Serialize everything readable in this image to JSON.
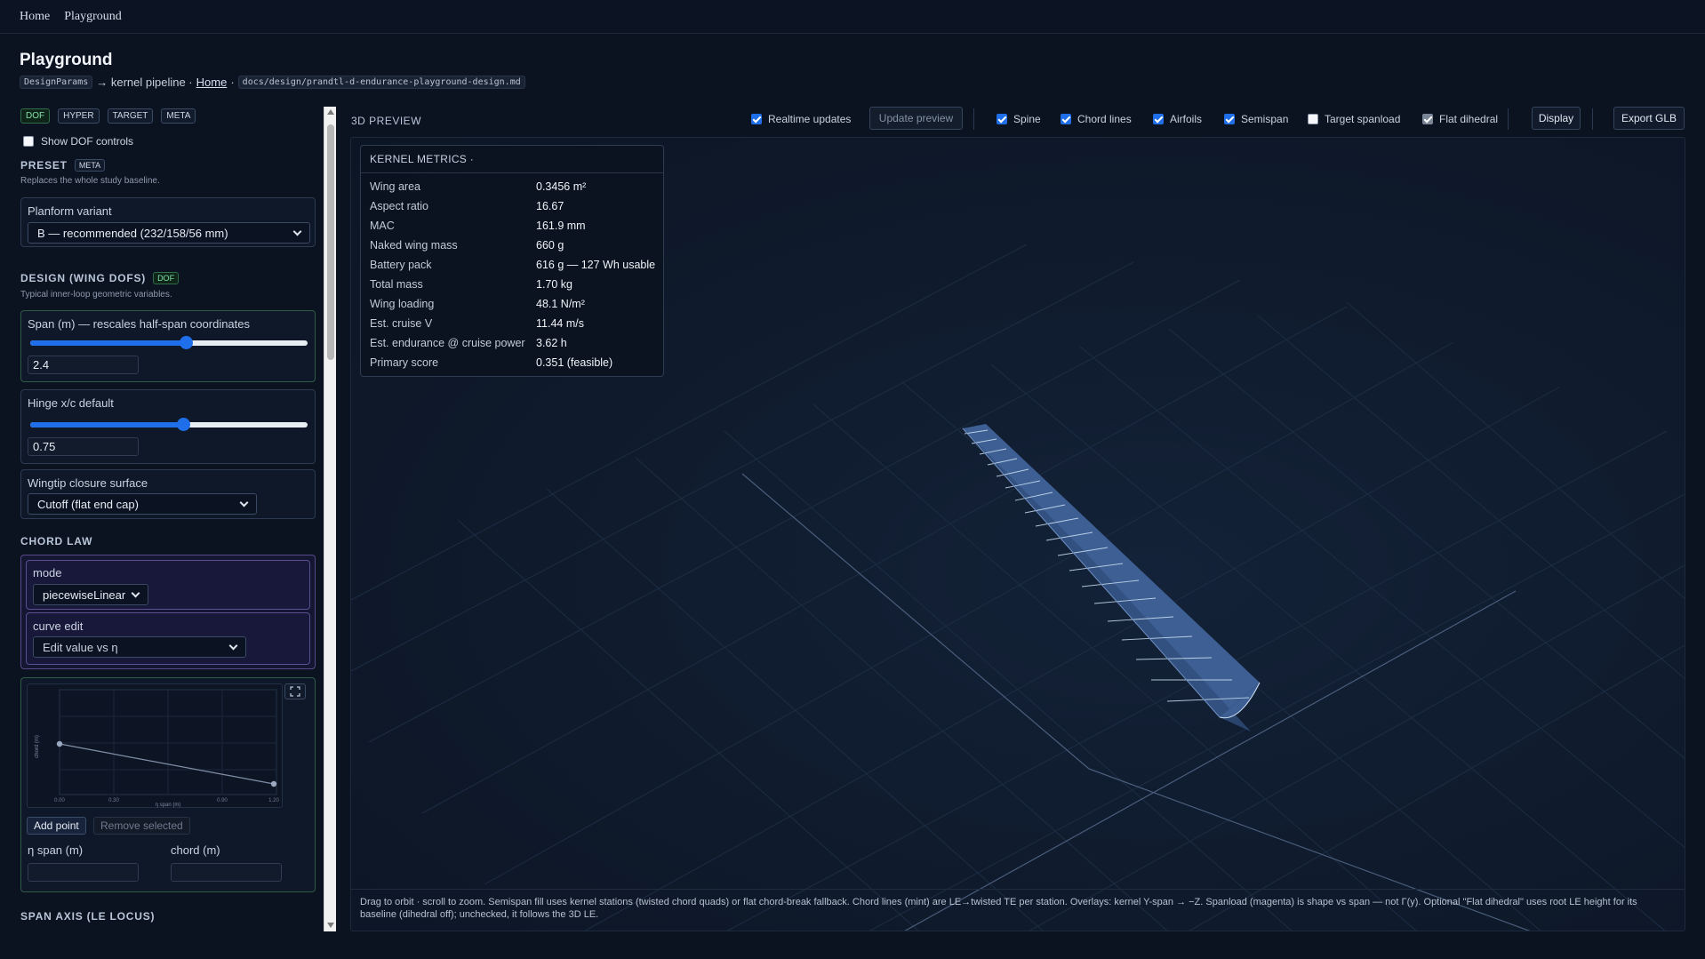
{
  "nav": {
    "home": "Home",
    "playground": "Playground"
  },
  "header": {
    "title": "Playground",
    "code_params": "DesignParams",
    "pipeline_text": "→ kernel pipeline ·",
    "home_link": "Home",
    "dot": "·",
    "doc_path": "docs/design/prandtl-d-endurance-playground-design.md"
  },
  "left": {
    "tags": [
      "DOF",
      "HYPER",
      "TARGET",
      "META"
    ],
    "show_dof": {
      "label": "Show DOF controls",
      "checked": false
    },
    "preset": {
      "heading": "PRESET",
      "tag": "META",
      "sub": "Replaces the whole study baseline.",
      "label": "Planform variant",
      "value": "B — recommended (232/158/56 mm)"
    },
    "design": {
      "heading": "DESIGN (WING DOFS)",
      "tag": "DOF",
      "sub": "Typical inner-loop geometric variables.",
      "span": {
        "label": "Span (m) — rescales half-span coordinates",
        "value": "2.4",
        "level": 0.56
      },
      "hinge": {
        "label": "Hinge x/c default",
        "value": "0.75",
        "level": 0.55
      },
      "wingtip": {
        "label": "Wingtip closure surface",
        "value": "Cutoff (flat end cap)"
      }
    },
    "chord_law": {
      "heading": "CHORD LAW",
      "mode_label": "mode",
      "mode_value": "piecewiseLinear",
      "curve_label": "curve edit",
      "curve_value": "Edit value vs η",
      "chart_ylabel": "chord (m)",
      "chart_xlabel": "η span (m)",
      "chart_ticks": [
        "0.00",
        "0.30",
        "0.90",
        "1.20"
      ],
      "add_point": "Add point",
      "remove_selected": "Remove selected",
      "eta_label": "η span (m)",
      "chord_label": "chord (m)",
      "expand_icon": "expand-icon"
    },
    "span_axis": {
      "heading": "SPAN AXIS (LE LOCUS)"
    }
  },
  "preview": {
    "heading": "3D PREVIEW",
    "toolbar": {
      "realtime": {
        "label": "Realtime updates",
        "checked": true
      },
      "update_btn": "Update preview",
      "spine": {
        "label": "Spine",
        "checked": true
      },
      "chord_lines": {
        "label": "Chord lines",
        "checked": true
      },
      "airfoils": {
        "label": "Airfoils",
        "checked": true
      },
      "semispan": {
        "label": "Semispan",
        "checked": true
      },
      "target_spanload": {
        "label": "Target spanload",
        "checked": false
      },
      "flat_dihedral": {
        "label": "Flat dihedral",
        "checked": true
      },
      "display_btn": "Display",
      "export_btn": "Export GLB"
    },
    "metrics": {
      "heading": "KERNEL METRICS ·",
      "rows": [
        {
          "k": "Wing area",
          "v": "0.3456 m²"
        },
        {
          "k": "Aspect ratio",
          "v": "16.67"
        },
        {
          "k": "MAC",
          "v": "161.9 mm"
        },
        {
          "k": "Naked wing mass",
          "v": "660 g"
        },
        {
          "k": "Battery pack",
          "v": "616 g — 127 Wh usable"
        },
        {
          "k": "Total mass",
          "v": "1.70 kg"
        },
        {
          "k": "Wing loading",
          "v": "48.1 N/m²"
        },
        {
          "k": "Est. cruise V",
          "v": "11.44 m/s"
        },
        {
          "k": "Est. endurance @ cruise power",
          "v": "3.62 h"
        },
        {
          "k": "Primary score",
          "v": "0.351 (feasible)"
        }
      ]
    },
    "caption": "Drag to orbit · scroll to zoom. Semispan fill uses kernel stations (twisted chord quads) or flat chord-break fallback. Chord lines (mint) are LE→twisted TE per station. Overlays: kernel Y-span → −Z. Spanload (magenta) is shape vs span — not Γ(y). Optional \"Flat dihedral\" uses root LE height for its baseline (dihedral off); unchecked, it follows the 3D LE."
  },
  "colors": {
    "accent": "#1f6feb",
    "wing": "#3e5f94",
    "chord_lines": "#cfe3f5"
  }
}
